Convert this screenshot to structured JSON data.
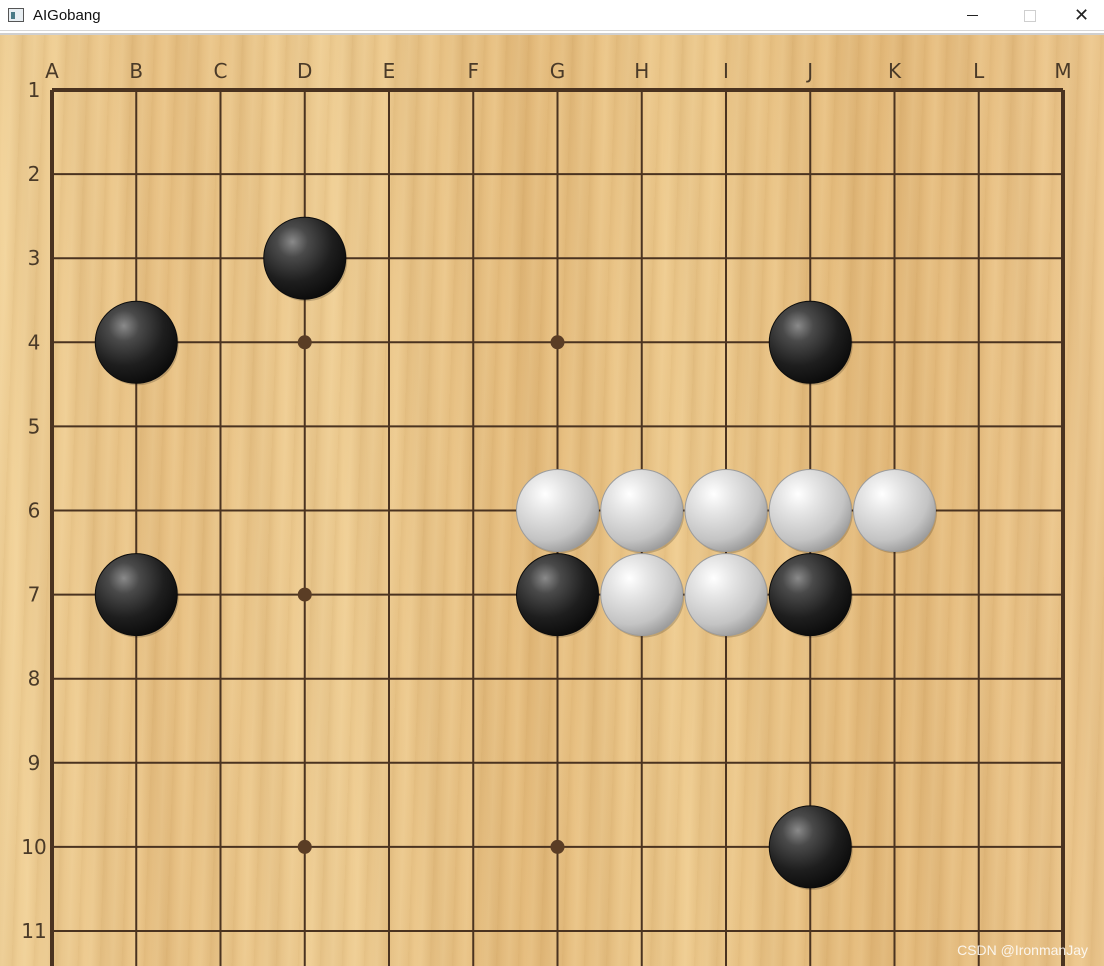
{
  "window": {
    "title": "AIGobang",
    "minimize_glyph": "",
    "close_glyph": "✕"
  },
  "board": {
    "columns": [
      "A",
      "B",
      "C",
      "D",
      "E",
      "F",
      "G",
      "H",
      "I",
      "J",
      "K",
      "L",
      "M"
    ],
    "rows": [
      "1",
      "2",
      "3",
      "4",
      "5",
      "6",
      "7",
      "8",
      "9",
      "10",
      "11"
    ],
    "star_points": [
      "D4",
      "G4",
      "D7",
      "D10",
      "G10"
    ],
    "stones": [
      {
        "pos": "D3",
        "color": "black"
      },
      {
        "pos": "B4",
        "color": "black"
      },
      {
        "pos": "J4",
        "color": "black"
      },
      {
        "pos": "G6",
        "color": "white"
      },
      {
        "pos": "H6",
        "color": "white"
      },
      {
        "pos": "I6",
        "color": "white"
      },
      {
        "pos": "J6",
        "color": "white"
      },
      {
        "pos": "K6",
        "color": "white"
      },
      {
        "pos": "B7",
        "color": "black"
      },
      {
        "pos": "G7",
        "color": "black"
      },
      {
        "pos": "H7",
        "color": "white"
      },
      {
        "pos": "I7",
        "color": "white"
      },
      {
        "pos": "J7",
        "color": "black"
      },
      {
        "pos": "J10",
        "color": "black"
      }
    ]
  },
  "watermark": "CSDN @IronmanJay",
  "colors": {
    "grid_line": "#4a3320",
    "black_stone": "#1c1c1c",
    "white_stone": "#d8d8d8"
  }
}
